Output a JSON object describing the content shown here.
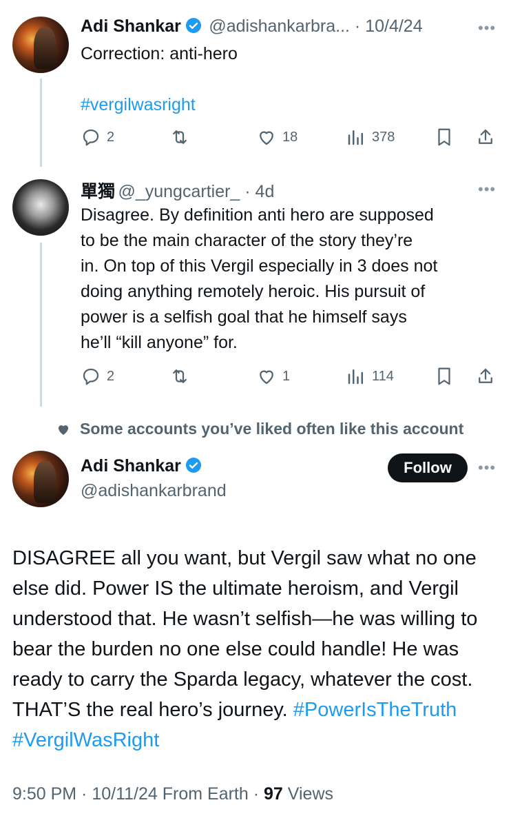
{
  "tweet1": {
    "name": "Adi Shankar",
    "handle": "@adishankarbra...",
    "date": "10/4/24",
    "line1": "Correction: anti-hero",
    "hashtag": "#vergilwasright",
    "replies": "2",
    "likes": "18",
    "views": "378"
  },
  "tweet2": {
    "name": "單獨",
    "handle": "@_yungcartier_",
    "date": "4d",
    "text_lines": [
      "Disagree. By definition anti hero are supposed",
      "to be the main character of the story they’re",
      "in. On top of this Vergil especially in 3 does not",
      "doing anything remotely heroic. His pursuit of",
      "power is a selfish goal that he himself says",
      "he’ll “kill anyone” for."
    ],
    "replies": "2",
    "likes": "1",
    "views": "114"
  },
  "social_context": "Some accounts you’ve liked often like this account",
  "main_tweet": {
    "name": "Adi Shankar",
    "handle": "@adishankarbrand",
    "follow_label": "Follow",
    "text": "DISAGREE all you want, but Vergil saw what no one else did. Power IS the ultimate heroism, and Vergil understood that. He wasn’t selfish—he was willing to bear the burden no one else could handle! He was ready to carry the Sparda legacy, whatever the cost. THAT’S the real hero’s journey.",
    "hashtag1": "#PowerIsTheTruth",
    "hashtag2": "#VergilWasRight",
    "time": "9:50 PM",
    "date": "10/11/24",
    "source": "From Earth",
    "views_count": "97",
    "views_label": "Views"
  },
  "colors": {
    "accent": "#1d9bf0",
    "text": "#0f1419",
    "muted": "#536471"
  }
}
